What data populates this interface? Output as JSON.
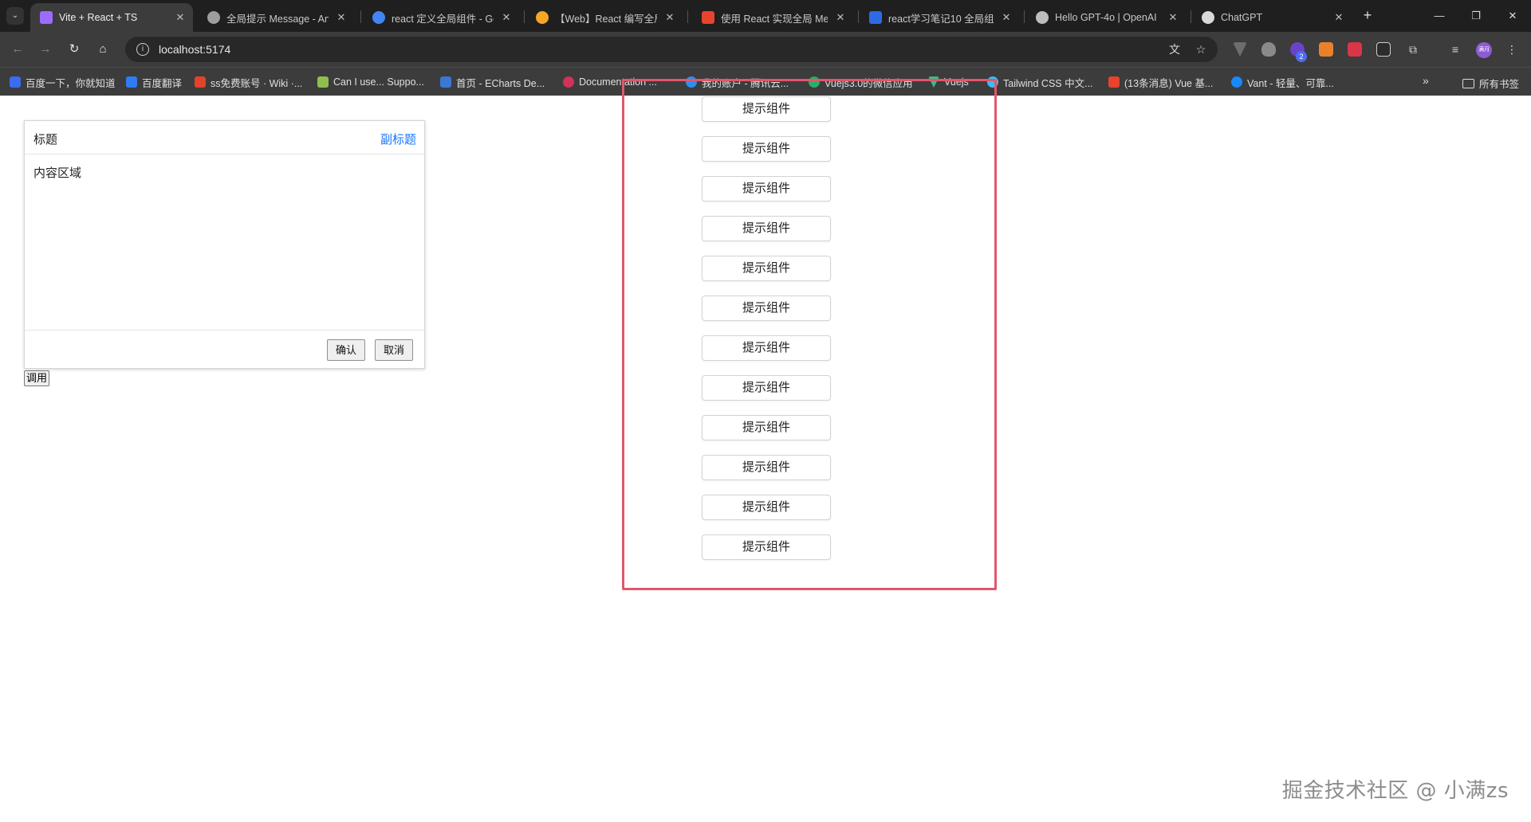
{
  "browser": {
    "tabs": [
      {
        "title": "Vite + React + TS",
        "active": true,
        "color": "#9b6cff"
      },
      {
        "title": "全局提示 Message - Ant",
        "active": false,
        "color": "#9e9e9e"
      },
      {
        "title": "react 定义全局组件 - Go",
        "active": false,
        "color": "#4285f4"
      },
      {
        "title": "【Web】React 编写全局",
        "active": false,
        "color": "#f5a623"
      },
      {
        "title": "使用 React 实现全局 Me",
        "active": false,
        "color": "#e8432d"
      },
      {
        "title": "react学习笔记10 全局组",
        "active": false,
        "color": "#2d6be4"
      },
      {
        "title": "Hello GPT-4o | OpenAI",
        "active": false,
        "color": "#bdbdbd"
      },
      {
        "title": "ChatGPT",
        "active": false,
        "color": "#d9d9d9"
      }
    ],
    "url": "localhost:5174",
    "bookmarks": [
      {
        "label": "百度一下，你就知道",
        "color": "#3b6cf0"
      },
      {
        "label": "百度翻译",
        "color": "#2e7cf6"
      },
      {
        "label": "ss免费账号 · Wiki ·...",
        "color": "#e24329"
      },
      {
        "label": "Can I use... Suppo...",
        "color": "#8fbf4d"
      },
      {
        "label": "首页 - ECharts De...",
        "color": "#3a78d4"
      },
      {
        "label": "Documentation ...",
        "color": "#d1325a"
      },
      {
        "label": "我的账户 - 腾讯云...",
        "color": "#2f8ef5"
      },
      {
        "label": "Vuejs3.0的微信应用",
        "color": "#2aae67"
      },
      {
        "label": "Vuejs",
        "color": "#41b883"
      },
      {
        "label": "Tailwind CSS 中文...",
        "color": "#38bdf8"
      },
      {
        "label": "(13条消息) Vue 基...",
        "color": "#e8432d"
      },
      {
        "label": "Vant - 轻量、可靠...",
        "color": "#1989fa"
      }
    ],
    "all_bookmarks_label": "所有书签",
    "profile_label": "满月",
    "extension_badge": "2"
  },
  "dialog": {
    "title": "标题",
    "subtitle": "副标题",
    "content": "内容区域",
    "confirm_label": "确认",
    "cancel_label": "取消"
  },
  "call_button_label": "调用",
  "toast_buttons": [
    "提示组件",
    "提示组件",
    "提示组件",
    "提示组件",
    "提示组件",
    "提示组件",
    "提示组件",
    "提示组件",
    "提示组件",
    "提示组件",
    "提示组件",
    "提示组件"
  ],
  "highlight_color": "#e2566a",
  "watermark": "掘金技术社区 @ 小满zs"
}
